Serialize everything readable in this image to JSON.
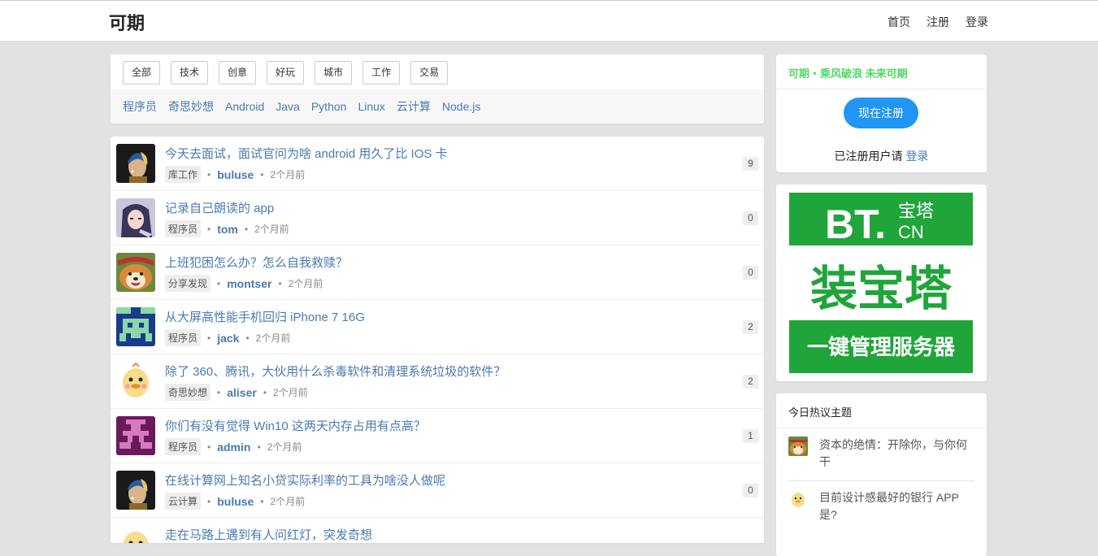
{
  "header": {
    "brand": "可期",
    "nav": [
      "首页",
      "注册",
      "登录"
    ]
  },
  "categories": [
    "全部",
    "技术",
    "创意",
    "好玩",
    "城市",
    "工作",
    "交易"
  ],
  "tags": [
    "程序员",
    "奇思妙想",
    "Android",
    "Java",
    "Python",
    "Linux",
    "云计算",
    "Node.js"
  ],
  "topics": [
    {
      "title": "今天去面试，面试官问为啥 android 用久了比 IOS 卡",
      "node": "库工作",
      "author": "buluse",
      "time": "2个月前",
      "replies": "9",
      "avatar": "pearl-earring-avatar"
    },
    {
      "title": "记录自己朗读的 app",
      "node": "程序员",
      "author": "tom",
      "time": "2个月前",
      "replies": "0",
      "avatar": "anime-girl-avatar"
    },
    {
      "title": "上班犯困怎么办？怎么自我救赎？",
      "node": "分享发现",
      "author": "montser",
      "time": "2个月前",
      "replies": "0",
      "avatar": "shiba-dog-avatar"
    },
    {
      "title": "从大屏高性能手机回归 iPhone 7 16G",
      "node": "程序员",
      "author": "jack",
      "time": "2个月前",
      "replies": "2",
      "avatar": "pixel-invader-avatar"
    },
    {
      "title": "除了 360、腾讯，大伙用什么杀毒软件和清理系统垃圾的软件？",
      "node": "奇思妙想",
      "author": "aliser",
      "time": "2个月前",
      "replies": "2",
      "avatar": "cartoon-duck-avatar"
    },
    {
      "title": "你们有没有觉得 Win10 这两天内存占用有点高？",
      "node": "程序员",
      "author": "admin",
      "time": "2个月前",
      "replies": "1",
      "avatar": "pixel-purple-avatar"
    },
    {
      "title": "在线计算网上知名小贷实际利率的工具为啥没人做呢",
      "node": "云计算",
      "author": "buluse",
      "time": "2个月前",
      "replies": "0",
      "avatar": "pearl-earring-avatar"
    },
    {
      "title": "走在马路上遇到有人问红灯，突发奇想",
      "node": "",
      "author": "",
      "time": "",
      "replies": "",
      "avatar": "cartoon-duck-avatar"
    }
  ],
  "sidebar": {
    "slogan": "可期・乘风破浪 未来可期",
    "register_button": "现在注册",
    "login_prefix": "已注册用户请",
    "login_link": "登录",
    "ad": {
      "logo_main": "BT.",
      "logo_cn": "宝塔",
      "logo_domain": "CN",
      "headline": "装宝塔",
      "tagline": "一键管理服务器",
      "color": "#20a53a"
    },
    "hot_title": "今日热议主题",
    "hot_items": [
      {
        "text": "资本的绝情：开除你，与你何干",
        "avatar": "shiba-dog-avatar"
      },
      {
        "text": "目前设计感最好的银行 APP 是?",
        "avatar": "cartoon-duck-avatar"
      }
    ]
  },
  "colors": {
    "link": "#4a7ab0",
    "accent_button": "#2196f3",
    "slogan_green": "#4cd964",
    "page_bg": "#e2e2e2"
  }
}
